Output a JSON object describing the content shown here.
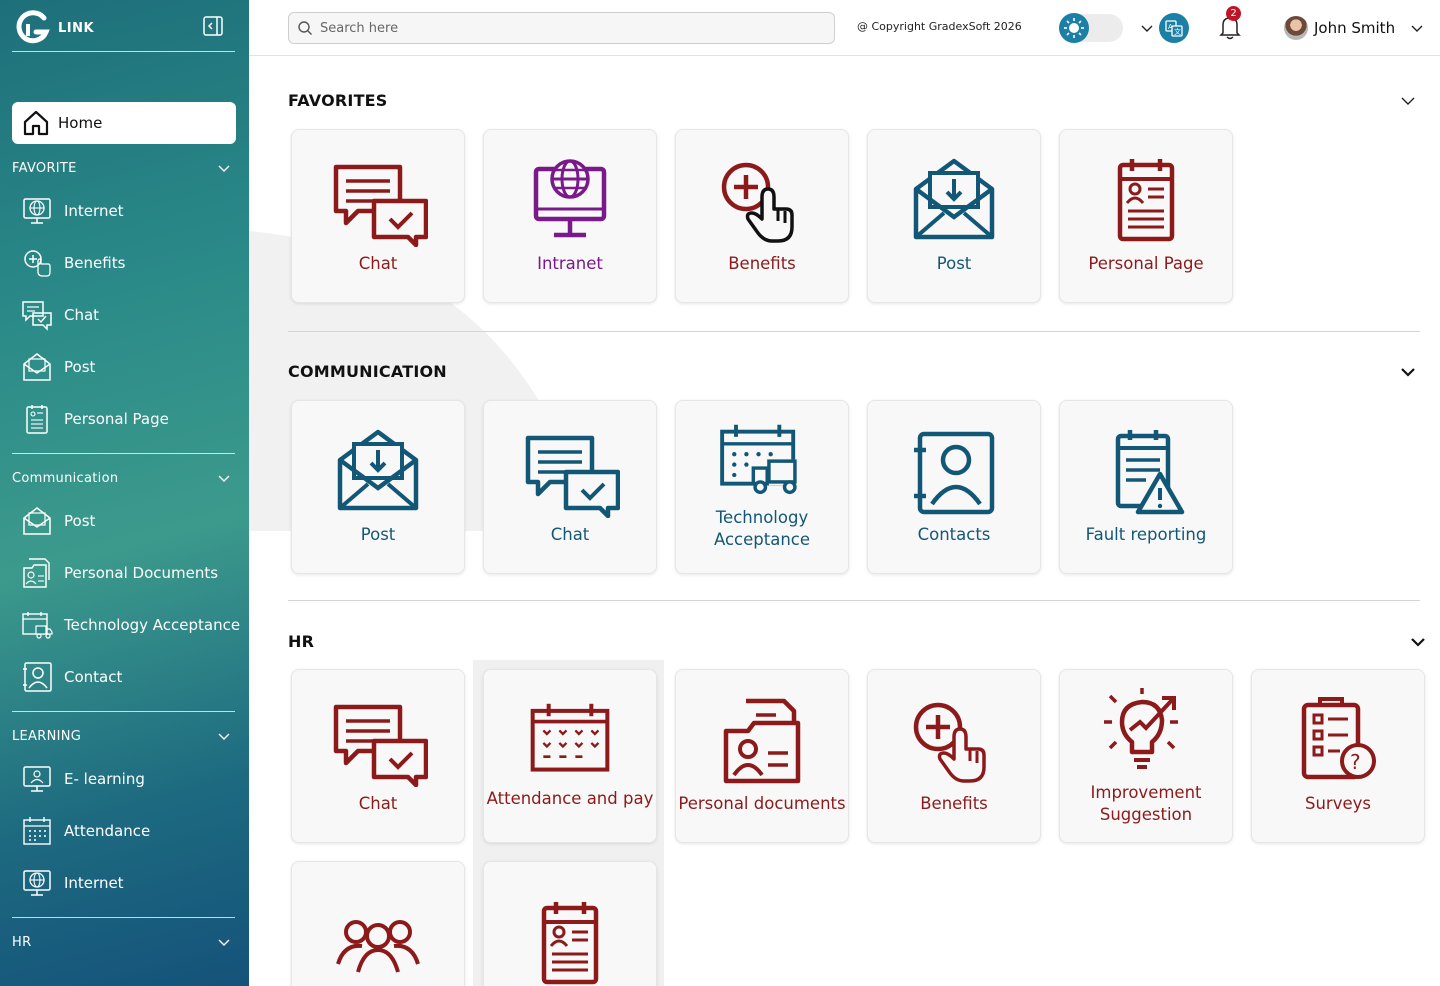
{
  "brand": {
    "name": "LINK"
  },
  "sidebar": {
    "home_label": "Home",
    "groups": [
      {
        "label": "FAVORITE",
        "items": [
          {
            "label": "Internet",
            "icon": "globe-monitor-icon"
          },
          {
            "label": "Benefits",
            "icon": "benefits-hand-icon"
          },
          {
            "label": "Chat",
            "icon": "chat-icon"
          },
          {
            "label": "Post",
            "icon": "mail-icon"
          },
          {
            "label": "Personal Page",
            "icon": "clipboard-icon"
          }
        ]
      },
      {
        "label": "Communication",
        "items": [
          {
            "label": "Post",
            "icon": "mail-icon"
          },
          {
            "label": "Personal Documents",
            "icon": "documents-icon"
          },
          {
            "label": "Technology Acceptance",
            "icon": "calendar-truck-icon"
          },
          {
            "label": "Contact",
            "icon": "contact-icon"
          }
        ]
      },
      {
        "label": "LEARNING",
        "items": [
          {
            "label": "E- learning",
            "icon": "elearning-icon"
          },
          {
            "label": "Attendance",
            "icon": "calendar-icon"
          },
          {
            "label": "Internet",
            "icon": "globe-monitor-icon"
          }
        ]
      },
      {
        "label": "HR",
        "items": []
      }
    ]
  },
  "topbar": {
    "search_placeholder": "Search here",
    "copyright": "@ Copyright GradexSoft 2026",
    "notifications_count": "2",
    "user_name": "John Smith"
  },
  "sections": [
    {
      "title": "FAVORITES",
      "cards": [
        {
          "label": "Chat",
          "color": "#8c1a1a"
        },
        {
          "label": "Intranet",
          "color": "#7a1a8a"
        },
        {
          "label": "Benefits",
          "color": "#8c1a1a"
        },
        {
          "label": "Post",
          "color": "#135777"
        },
        {
          "label": "Personal Page",
          "color": "#8c1a1a"
        }
      ]
    },
    {
      "title": "COMMUNICATION",
      "cards": [
        {
          "label": "Post",
          "color": "#135777"
        },
        {
          "label": "Chat",
          "color": "#135777"
        },
        {
          "label": "Technology Acceptance",
          "color": "#135777"
        },
        {
          "label": "Contacts",
          "color": "#135777"
        },
        {
          "label": "Fault reporting",
          "color": "#135777"
        }
      ]
    },
    {
      "title": "HR",
      "cards": [
        {
          "label": "Chat",
          "color": "#8c1a1a"
        },
        {
          "label": "Attendance and pay",
          "color": "#8c1a1a"
        },
        {
          "label": "Personal documents",
          "color": "#8c1a1a"
        },
        {
          "label": "Benefits",
          "color": "#8c1a1a"
        },
        {
          "label": "Improvement Suggestion",
          "color": "#8c1a1a"
        },
        {
          "label": "Surveys",
          "color": "#8c1a1a"
        },
        {
          "label": "",
          "color": "#8c1a1a"
        },
        {
          "label": "",
          "color": "#8c1a1a"
        }
      ]
    }
  ]
}
